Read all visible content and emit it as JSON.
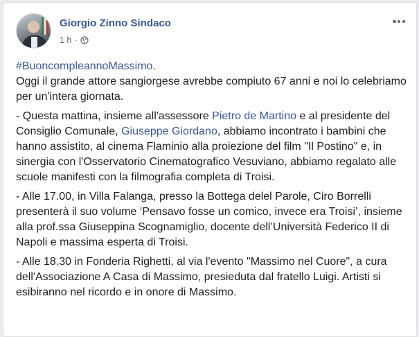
{
  "post": {
    "author": "Giorgio Zinno Sindaco",
    "timestamp": "1 h",
    "separator": "·",
    "hashtag": "#BuoncompleannoMassimo",
    "hashtag_suffix": ".",
    "intro": "Oggi il grande attore sangiorgese avrebbe compiuto 67 anni e noi lo celebriamo per un'intera giornata.",
    "p1": {
      "a": "- Questa mattina, insieme all'assessore ",
      "mention1": "Pietro de Martino",
      "b": " e al presidente del Consiglio Comunale, ",
      "mention2": "Giuseppe Giordano",
      "c": ", abbiamo incontrato i bambini che hanno assistito, al cinema Flaminio alla proiezione del film \"Il Postino\" e, in sinergia con l'Osservatorio Cinematografico Vesuviano, abbiamo regalato alle scuole manifesti con la filmografia completa di Troisi."
    },
    "p2": "- Alle 17.00, in Villa Falanga, presso la Bottega delel Parole, Ciro Borrelli presenterà il suo volume ‘Pensavo fosse un comico, invece era Troisi’, insieme alla prof.ssa Giuseppina Scognamiglio, docente dell’Università Federico II di Napoli e massima esperta di Troisi.",
    "p3": "- Alle 18.30 in Fonderia Righetti, al via l'evento \"Massimo nel Cuore\", a cura dell'Associazione A Casa di Massimo, presieduta dal fratello Luigi. Artisti si esibiranno nel ricordo e in onore di Massimo."
  },
  "icons": {
    "privacy": "globe-icon",
    "menu": "more-icon"
  },
  "colors": {
    "link": "#385898",
    "meta": "#606770",
    "text": "#1c1e21",
    "card": "#ffffff",
    "page": "#e9ebee"
  }
}
